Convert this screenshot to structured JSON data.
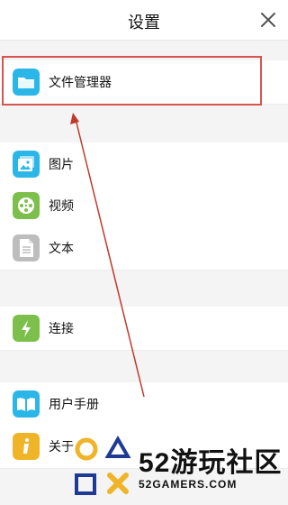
{
  "header": {
    "title": "设置"
  },
  "items": [
    {
      "label": "文件管理器",
      "icon": "folder-icon",
      "color": "#2bb6e8"
    },
    {
      "label": "图片",
      "icon": "image-icon",
      "color": "#2bb6e8"
    },
    {
      "label": "视频",
      "icon": "film-reel-icon",
      "color": "#7cc04b"
    },
    {
      "label": "文本",
      "icon": "document-icon",
      "color": "#bdbdbd"
    },
    {
      "label": "连接",
      "icon": "lightning-icon",
      "color": "#7cc04b"
    },
    {
      "label": "用户手册",
      "icon": "book-icon",
      "color": "#2bb6e8"
    },
    {
      "label": "关于",
      "icon": "info-icon",
      "color": "#f0b429"
    }
  ],
  "watermark": {
    "big_text": "52游玩社区",
    "small_text": "52GAMERS.COM"
  },
  "annotation": {
    "box_color": "#d9534f",
    "arrow_color": "#c0392b"
  }
}
